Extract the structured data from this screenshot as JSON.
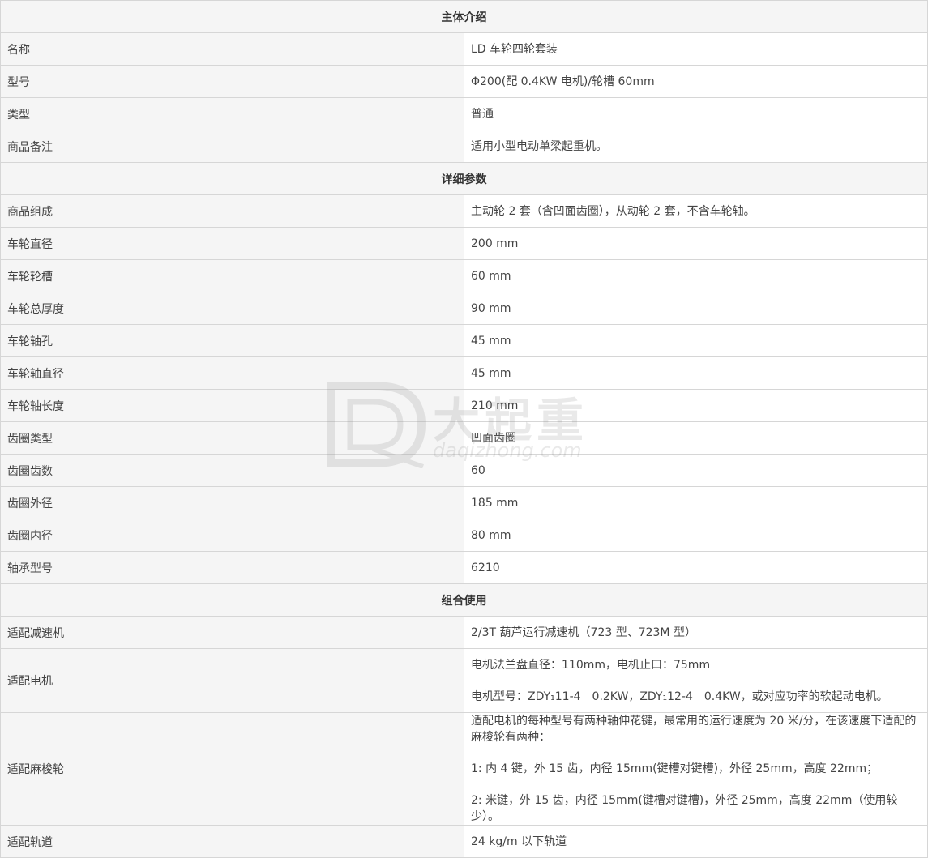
{
  "sections": [
    {
      "title": "主体介绍",
      "rows": [
        {
          "label": "名称",
          "lines": [
            "LD 车轮四轮套装"
          ]
        },
        {
          "label": "型号",
          "lines": [
            "Φ200(配 0.4KW 电机)/轮槽 60mm"
          ]
        },
        {
          "label": "类型",
          "lines": [
            "普通"
          ]
        },
        {
          "label": "商品备注",
          "lines": [
            "适用小型电动单梁起重机。"
          ]
        }
      ]
    },
    {
      "title": "详细参数",
      "rows": [
        {
          "label": "商品组成",
          "lines": [
            "主动轮 2 套（含凹面齿圈），从动轮 2 套，不含车轮轴。"
          ]
        },
        {
          "label": "车轮直径",
          "lines": [
            "200 mm"
          ]
        },
        {
          "label": "车轮轮槽",
          "lines": [
            "60 mm"
          ]
        },
        {
          "label": "车轮总厚度",
          "lines": [
            "90 mm"
          ]
        },
        {
          "label": "车轮轴孔",
          "lines": [
            "45 mm"
          ]
        },
        {
          "label": "车轮轴直径",
          "lines": [
            "45 mm"
          ]
        },
        {
          "label": "车轮轴长度",
          "lines": [
            "210 mm"
          ]
        },
        {
          "label": "齿圈类型",
          "lines": [
            "凹面齿圈"
          ]
        },
        {
          "label": "齿圈齿数",
          "lines": [
            "60"
          ]
        },
        {
          "label": "齿圈外径",
          "lines": [
            "185 mm"
          ]
        },
        {
          "label": "齿圈内径",
          "lines": [
            "80 mm"
          ]
        },
        {
          "label": "轴承型号",
          "lines": [
            "6210"
          ]
        }
      ]
    },
    {
      "title": "组合使用",
      "rows": [
        {
          "label": "适配减速机",
          "lines": [
            "2/3T 葫芦运行减速机（723 型、723M 型）"
          ]
        },
        {
          "label": "适配电机",
          "lines": [
            "电机法兰盘直径：110mm，电机止口：75mm",
            "电机型号：ZDY₁11-4　0.2KW，ZDY₁12-4　0.4KW，或对应功率的软起动电机。"
          ]
        },
        {
          "label": "适配麻梭轮",
          "lines": [
            "适配电机的每种型号有两种轴伸花键，最常用的运行速度为 20 米/分，在该速度下适配的麻梭轮有两种：",
            "1: 内 4 键，外 15 齿，内径 15mm(键槽对键槽)，外径 25mm，高度 22mm；",
            "2: 米键，外 15 齿，内径 15mm(键槽对键槽)，外径 25mm，高度 22mm（使用较少）。"
          ]
        },
        {
          "label": "适配轨道",
          "lines": [
            "24 kg/m 以下轨道"
          ]
        }
      ]
    }
  ],
  "watermark": {
    "cn": "大起重",
    "en": "daqizhong.com"
  }
}
